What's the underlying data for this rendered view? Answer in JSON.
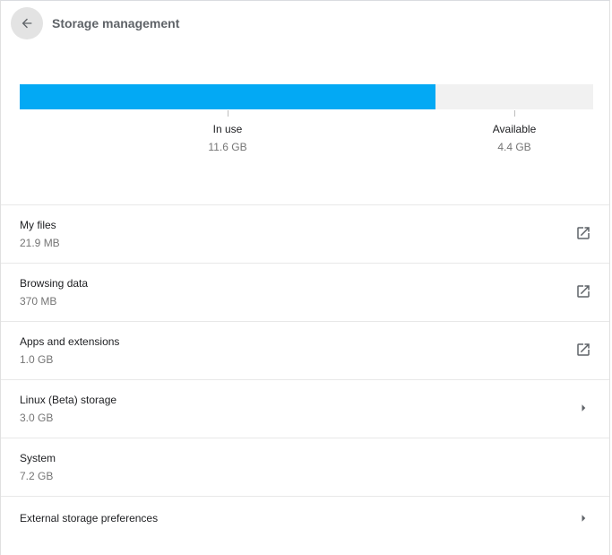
{
  "header": {
    "title": "Storage management"
  },
  "usage": {
    "in_use_label": "In use",
    "in_use_value": "11.6 GB",
    "available_label": "Available",
    "available_value": "4.4 GB",
    "in_use_fraction": 0.725
  },
  "colors": {
    "bar_fill": "#03a9f4",
    "bar_track": "#f1f1f1"
  },
  "items": [
    {
      "name": "My files",
      "size": "21.9 MB",
      "icon": "open-external-icon"
    },
    {
      "name": "Browsing data",
      "size": "370 MB",
      "icon": "open-external-icon"
    },
    {
      "name": "Apps and extensions",
      "size": "1.0 GB",
      "icon": "open-external-icon"
    },
    {
      "name": "Linux (Beta) storage",
      "size": "3.0 GB",
      "icon": "chevron-right-icon"
    },
    {
      "name": "System",
      "size": "7.2 GB"
    },
    {
      "name": "External storage preferences",
      "icon": "chevron-right-icon"
    }
  ]
}
